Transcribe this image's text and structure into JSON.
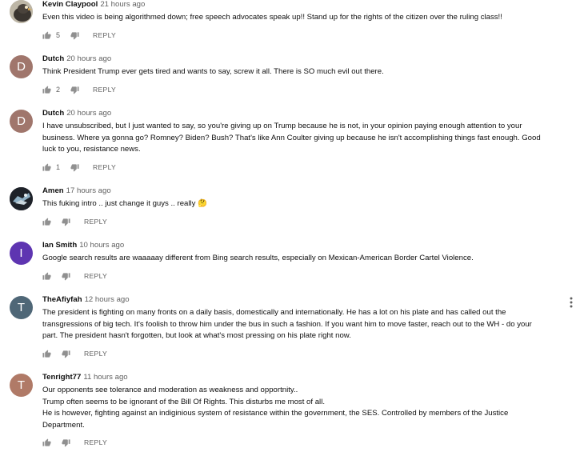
{
  "colors": {
    "avatar_dutch": "#a0766c",
    "avatar_ian": "#5e35b1",
    "avatar_theafiyfah": "#4f6777",
    "avatar_tenright": "#b07a67",
    "text_secondary": "#606060",
    "icon": "#909090"
  },
  "comments": [
    {
      "author": "Kevin Claypool",
      "time": "21 hours ago",
      "avatar": "photo-avatar",
      "lines": [
        "Even this video is being algorithmed down; free speech advocates speak up!! Stand up for the rights of the citizen over the ruling class!!"
      ],
      "likes": "5",
      "reply": "REPLY"
    },
    {
      "author": "Dutch",
      "time": "20 hours ago",
      "avatar_letter": "D",
      "lines": [
        "Think President Trump ever gets tired and wants to say, screw it all. There is SO much evil out there."
      ],
      "likes": "2",
      "reply": "REPLY"
    },
    {
      "author": "Dutch",
      "time": "20 hours ago",
      "avatar_letter": "D",
      "lines": [
        "I have unsubscribed, but I just wanted to say, so you're giving up on Trump because he is not, in your opinion paying enough attention to your",
        "business. Where ya gonna go? Romney? Biden? Bush? That's like Ann Coulter giving up because he isn't accomplishing things fast enough. Good",
        "luck to you, resistance news."
      ],
      "likes": "1",
      "reply": "REPLY"
    },
    {
      "author": "Amen",
      "time": "17 hours ago",
      "avatar": "photo-avatar",
      "lines": [
        "This fuking intro .. just change it guys .. really 🤔"
      ],
      "likes": "",
      "reply": "REPLY"
    },
    {
      "author": "Ian Smith",
      "time": "10 hours ago",
      "avatar_letter": "I",
      "lines": [
        "Google search results are waaaaay different from Bing search results, especially on Mexican-American Border Cartel Violence."
      ],
      "likes": "",
      "reply": "REPLY"
    },
    {
      "author": "TheAfiyfah",
      "time": "12 hours ago",
      "avatar_letter": "T",
      "lines": [
        "The president is fighting on many fronts on a daily basis, domestically and internationally. He has a lot on his plate and has called out the",
        "transgressions of big tech. It's foolish to throw him under the bus in such a fashion. If you want him to move faster, reach out to the WH - do your",
        "part. The president hasn't forgotten, but look at what's most pressing on his plate right now."
      ],
      "likes": "",
      "reply": "REPLY"
    },
    {
      "author": "Tenright77",
      "time": "11 hours ago",
      "avatar_letter": "T",
      "lines": [
        "Our opponents see tolerance and moderation as weakness and opportnity..",
        "Trump often seems to be ignorant of the Bill Of Rights. This disturbs me most of all.",
        "He is however, fighting against an indiginious system of resistance within the government, the SES. Controlled by members of the Justice",
        "Department."
      ],
      "likes": "",
      "reply": "REPLY"
    }
  ]
}
